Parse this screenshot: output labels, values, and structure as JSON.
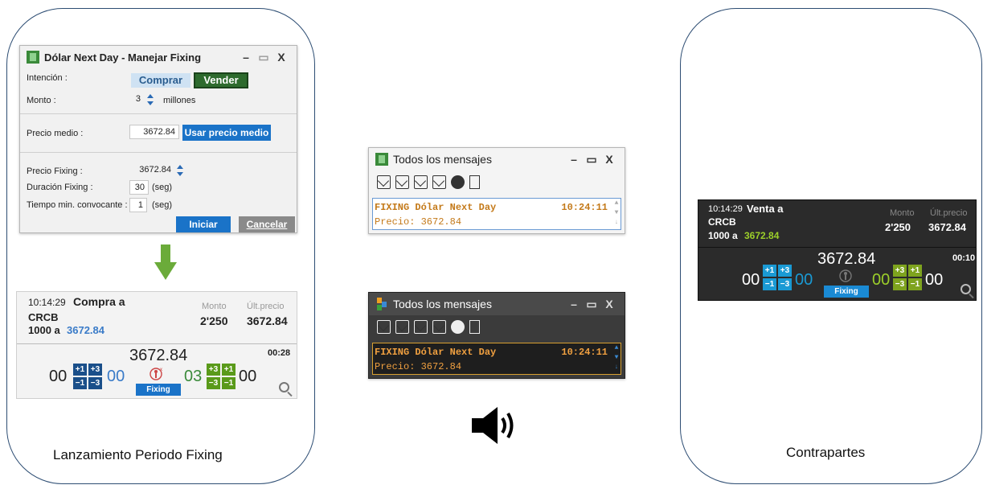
{
  "fixing_dialog": {
    "title": "Dólar Next Day - Manejar Fixing",
    "intencion_label": "Intención :",
    "comprar_label": "Comprar",
    "vender_label": "Vender",
    "monto_label": "Monto :",
    "monto_value": "3",
    "monto_unit": "millones",
    "precio_medio_label": "Precio medio :",
    "precio_medio_value": "3672.84",
    "usar_precio_medio_label": "Usar precio medio",
    "precio_fixing_label": "Precio Fixing :",
    "precio_fixing_value": "3672.84",
    "duracion_label": "Duración Fixing :",
    "duracion_value": "30",
    "duracion_unit": "(seg)",
    "tiempo_label": "Tiempo min. convocante :",
    "tiempo_value": "1",
    "tiempo_unit": "(seg)",
    "iniciar_label": "Iniciar",
    "cancelar_label": "Cancelar",
    "minimize": "–",
    "maximize": "▭",
    "close": "X"
  },
  "buy_card": {
    "time": "10:14:29",
    "action": "Compra a",
    "counterparty": "CRCB",
    "amount_prefix": "1000 a",
    "amount_price": "3672.84",
    "monto_header": "Monto",
    "ult_precio_header": "Últ.precio",
    "monto_value": "2'250",
    "ult_precio_value": "3672.84",
    "center_price": "3672.84",
    "timer": "00:28",
    "left_zero": "00",
    "mid_zero": "00",
    "right_count": "03",
    "right_zero": "00",
    "plus1": "+1",
    "plus3": "+3",
    "minus1": "−1",
    "minus3": "−3",
    "fixing_badge": "Fixing"
  },
  "sell_card": {
    "time": "10:14:29",
    "action": "Venta a",
    "counterparty": "CRCB",
    "amount_prefix": "1000 a",
    "amount_price": "3672.84",
    "monto_header": "Monto",
    "ult_precio_header": "Últ.precio",
    "monto_value": "2'250",
    "ult_precio_value": "3672.84",
    "center_price": "3672.84",
    "timer": "00:10",
    "left_zero": "00",
    "mid_zero": "00",
    "right_count": "00",
    "right_zero": "00",
    "plus1": "+1",
    "plus3": "+3",
    "minus1": "−1",
    "minus3": "−3",
    "fixing_badge": "Fixing"
  },
  "messages_light": {
    "title": "Todos los mensajes",
    "line1": "FIXING Dólar Next Day",
    "time": "10:24:11",
    "line2": "Precio: 3672.84",
    "minimize": "–",
    "maximize": "▭",
    "close": "X"
  },
  "messages_dark": {
    "title": "Todos los mensajes",
    "line1": "FIXING Dólar Next Day",
    "time": "10:24:11",
    "line2": "Precio: 3672.84",
    "minimize": "–",
    "maximize": "▭",
    "close": "X"
  },
  "captions": {
    "left": "Lanzamiento Periodo Fixing",
    "right": "Contrapartes"
  },
  "colors": {
    "frame_border": "#2d4d73",
    "buy_blue": "#1a4f8a",
    "sell_green": "#7ea31e",
    "msg_orange": "#c47a1a",
    "accent_blue": "#1a73c8"
  }
}
